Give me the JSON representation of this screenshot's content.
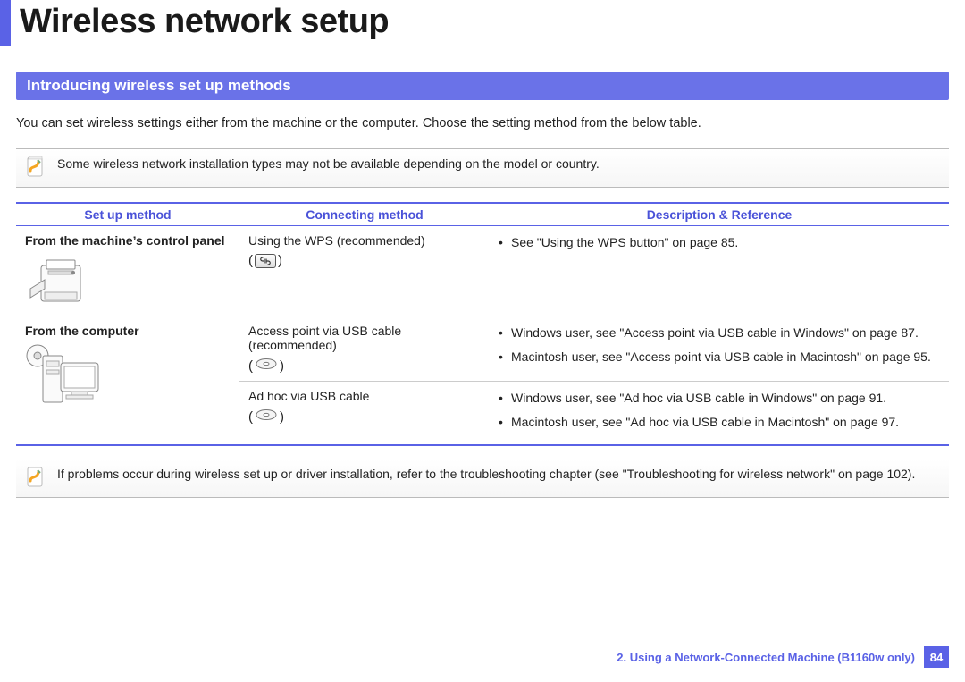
{
  "page_title": "Wireless network setup",
  "section_header": "Introducing wireless set up methods",
  "intro_text": "You can set wireless settings either from the machine or the computer. Choose the setting method from the below table.",
  "note1": "Some wireless network installation types may not be available depending on the model or country.",
  "table": {
    "headers": [
      "Set up method",
      "Connecting method",
      "Description & Reference"
    ],
    "rows": [
      {
        "setup": "From the machine’s control panel",
        "connect": "Using the WPS (recommended)",
        "refs": [
          "See \"Using the WPS button\" on page 85."
        ]
      },
      {
        "setup": "From the computer",
        "connect": "Access point via USB cable (recommended)",
        "refs": [
          "Windows user, see \"Access point via USB cable in Windows\" on page 87.",
          "Macintosh user, see \"Access point via USB cable in Macintosh\" on page 95."
        ]
      },
      {
        "setup": "",
        "connect": "Ad hoc via USB cable",
        "refs": [
          "Windows user, see \"Ad hoc via USB cable in Windows\" on page 91.",
          "Macintosh user, see \"Ad hoc via USB cable in Macintosh\" on page 97."
        ]
      }
    ]
  },
  "note2": "If problems occur during wireless set up or driver installation, refer to the troubleshooting chapter (see \"Troubleshooting for wireless network\" on page 102).",
  "footer_text": "2.  Using a Network-Connected Machine (B1160w only)",
  "page_number": "84"
}
